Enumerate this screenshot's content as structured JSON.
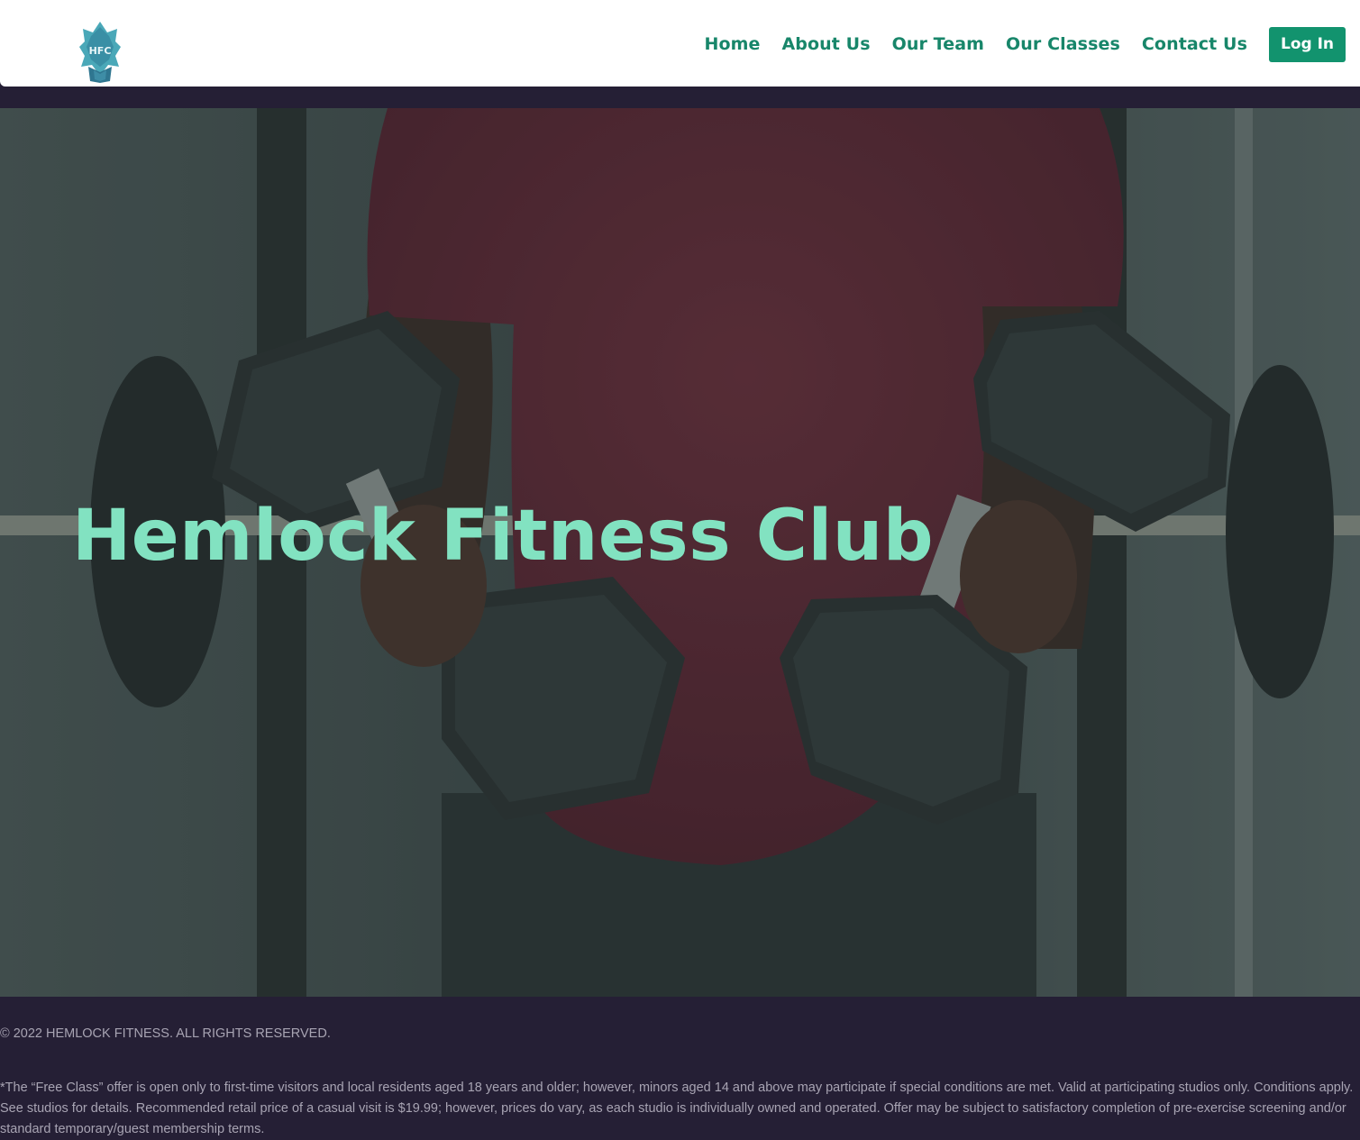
{
  "header": {
    "logo_text": "HFC",
    "nav": {
      "home": "Home",
      "about": "About Us",
      "team": "Our Team",
      "classes": "Our Classes",
      "contact": "Contact Us"
    },
    "login_label": "Log In"
  },
  "hero": {
    "title": "Hemlock Fitness Club"
  },
  "footer": {
    "copyright": "© 2022 HEMLOCK FITNESS. ALL RIGHTS RESERVED.",
    "disclaimer": "*The “Free Class” offer is open only to first-time visitors and local residents aged 18 years and older; however, minors aged 14 and above may participate if special conditions are met. Valid at participating studios only. Conditions apply. See studios for details. Recommended retail price of a casual visit is $19.99; however, prices do vary, as each studio is individually owned and operated. Offer may be subject to satisfactory completion of pre-exercise screening and/or standard temporary/guest membership terms."
  },
  "colors": {
    "brand_green": "#18866a",
    "button_green": "#12936e",
    "hero_title": "#82e2c1",
    "footer_bg": "#251f35"
  }
}
